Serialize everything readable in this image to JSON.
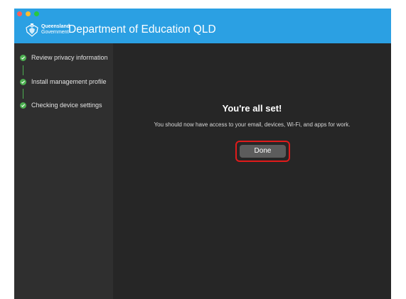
{
  "window": {
    "title": "Department of Education QLD",
    "logo_line1": "Queensland",
    "logo_line2": "Government",
    "accent_color": "#2ba0e3"
  },
  "steps": [
    {
      "label": "Review privacy information",
      "status": "complete",
      "icon": "check-circle-icon"
    },
    {
      "label": "Install management profile",
      "status": "complete",
      "icon": "check-circle-icon"
    },
    {
      "label": "Checking device settings",
      "status": "complete",
      "icon": "check-circle-icon"
    }
  ],
  "main": {
    "heading": "You're all set!",
    "message": "You should now have access to your email, devices, Wi-Fi, and apps for work.",
    "done_label": "Done"
  },
  "colors": {
    "step_complete": "#4caf50",
    "highlight": "#e01b1b"
  }
}
